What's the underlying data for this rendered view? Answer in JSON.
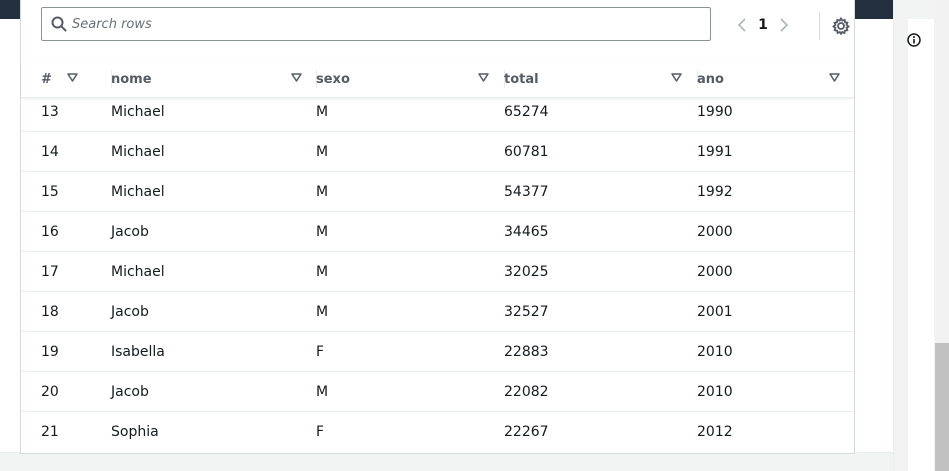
{
  "search": {
    "placeholder": "Search rows"
  },
  "pagination": {
    "current_page": "1"
  },
  "columns": [
    {
      "label": "#"
    },
    {
      "label": "nome"
    },
    {
      "label": "sexo"
    },
    {
      "label": "total"
    },
    {
      "label": "ano"
    }
  ],
  "rows": [
    {
      "num": "13",
      "nome": "Michael",
      "sexo": "M",
      "total": "65274",
      "ano": "1990"
    },
    {
      "num": "14",
      "nome": "Michael",
      "sexo": "M",
      "total": "60781",
      "ano": "1991"
    },
    {
      "num": "15",
      "nome": "Michael",
      "sexo": "M",
      "total": "54377",
      "ano": "1992"
    },
    {
      "num": "16",
      "nome": "Jacob",
      "sexo": "M",
      "total": "34465",
      "ano": "2000"
    },
    {
      "num": "17",
      "nome": "Michael",
      "sexo": "M",
      "total": "32025",
      "ano": "2000"
    },
    {
      "num": "18",
      "nome": "Jacob",
      "sexo": "M",
      "total": "32527",
      "ano": "2001"
    },
    {
      "num": "19",
      "nome": "Isabella",
      "sexo": "F",
      "total": "22883",
      "ano": "2010"
    },
    {
      "num": "20",
      "nome": "Jacob",
      "sexo": "M",
      "total": "22082",
      "ano": "2010"
    },
    {
      "num": "21",
      "nome": "Sophia",
      "sexo": "F",
      "total": "22267",
      "ano": "2012"
    }
  ],
  "icons": {
    "search": "search-icon",
    "prev": "chevron-left-icon",
    "next": "chevron-right-icon",
    "settings": "gear-icon",
    "sort": "caret-down-icon",
    "info": "info-icon"
  },
  "colors": {
    "topbar": "#232f3e",
    "text_primary": "#16191f",
    "text_secondary": "#545b64",
    "border": "#d5dbdb",
    "row_divider": "#eaeded"
  }
}
